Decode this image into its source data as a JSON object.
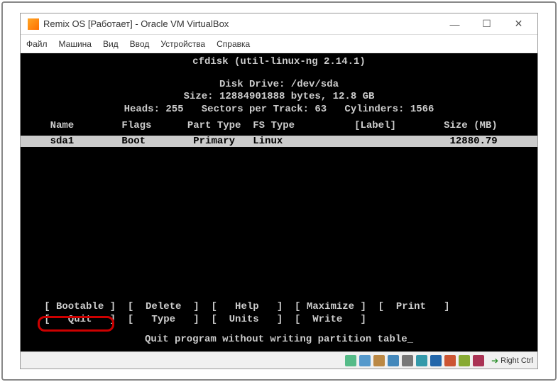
{
  "window": {
    "title": "Remix OS [Работает] - Oracle VM VirtualBox",
    "controls": {
      "minimize": "—",
      "maximize": "☐",
      "close": "✕"
    }
  },
  "menubar": {
    "file": "Файл",
    "machine": "Машина",
    "view": "Вид",
    "input": "Ввод",
    "devices": "Устройства",
    "help": "Справка"
  },
  "terminal": {
    "title": "cfdisk (util-linux-ng 2.14.1)",
    "drive": "Disk Drive: /dev/sda",
    "size": "Size: 12884901888 bytes, 12.8 GB",
    "geometry": "Heads: 255   Sectors per Track: 63   Cylinders: 1566",
    "headers": "    Name        Flags      Part Type  FS Type          [Label]        Size (MB)",
    "selected_row": "    sda1        Boot        Primary   Linux                            12880.79",
    "menu_row1": "   [ Bootable ]  [  Delete  ]  [   Help   ]  [ Maximize ]  [  Print   ]",
    "menu_row2": "   [   Quit   ]  [   Type   ]  [  Units   ]  [  Write   ]",
    "hint": "Quit program without writing partition table_",
    "options": {
      "bootable": "Bootable",
      "delete": "Delete",
      "help": "Help",
      "maximize": "Maximize",
      "print": "Print",
      "quit": "Quit",
      "type": "Type",
      "units": "Units",
      "write": "Write"
    }
  },
  "statusbar": {
    "host_key": "Right Ctrl",
    "icons": [
      "hdd-icon",
      "cd-icon",
      "disk-icon",
      "net-icon",
      "usb-icon",
      "share-icon",
      "video-icon",
      "mouse-icon",
      "clipboard-icon",
      "record-icon"
    ]
  }
}
